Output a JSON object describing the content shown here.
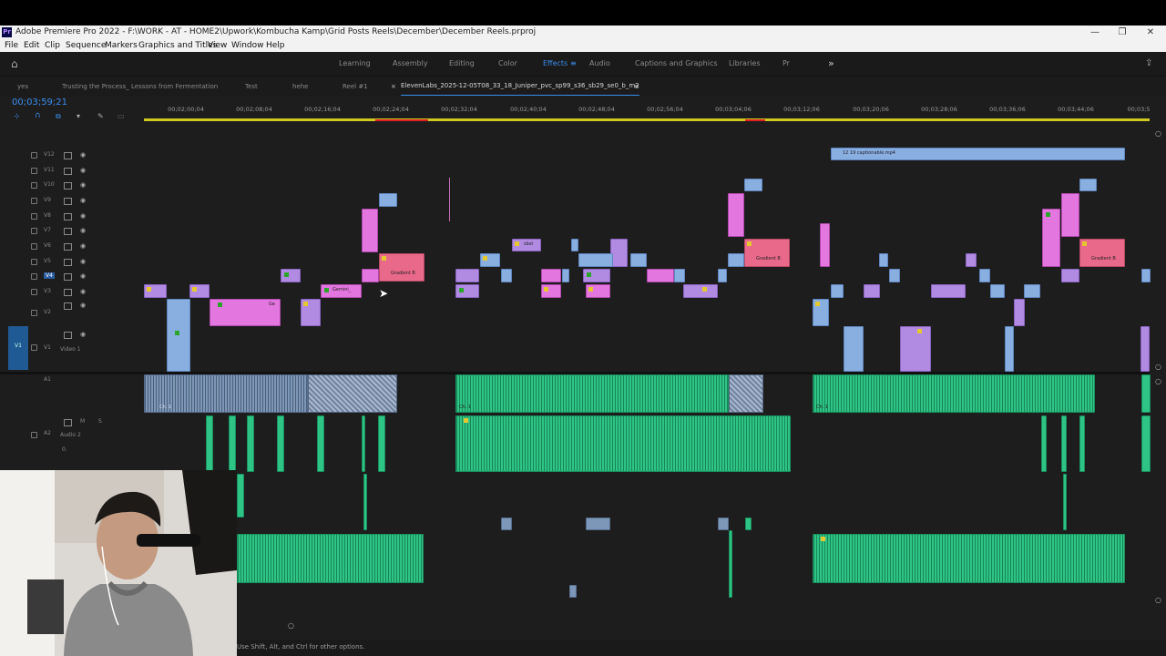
{
  "window": {
    "title": "Adobe Premiere Pro 2022 - F:\\WORK - AT - HOME2\\Upwork\\Kombucha Kamp\\Grid Posts Reels\\December\\December Reels.prproj",
    "app_badge": "Pr",
    "controls": [
      "—",
      "❐",
      "✕"
    ]
  },
  "menu": [
    "File",
    "Edit",
    "Clip",
    "Sequence",
    "Markers",
    "Graphics and Titles",
    "View",
    "Window",
    "Help"
  ],
  "workspaces": {
    "items": [
      "Learning",
      "Assembly",
      "Editing",
      "Color",
      "Effects",
      "Audio",
      "Captions and Graphics",
      "Libraries",
      "Pr"
    ],
    "active": "Effects",
    "more": "»"
  },
  "sequence_tabs": {
    "items": [
      "yes",
      "Trusting the Process_ Lessons from Fermentation",
      "Test",
      "hehe",
      "Reel #1",
      "ElevenLabs_2025-12-05T08_33_18_Juniper_pvc_sp99_s36_sb29_se0_b_m2"
    ],
    "close_glyph": "×",
    "menu_glyph": "≡"
  },
  "timecode": "00;03;59;21",
  "ruler_ticks": [
    "00;02;00;04",
    "00;02;08;04",
    "00;02;16;04",
    "00;02;24;04",
    "00;02;32;04",
    "00;02;40;04",
    "00;02;48;04",
    "00;02;56;04",
    "00;03;04;06",
    "00;03;12;06",
    "00;03;20;06",
    "00;03;28;06",
    "00;03;36;06",
    "00;03;44;06",
    "00;03;5"
  ],
  "video_tracks": [
    "V12",
    "V11",
    "V10",
    "V9",
    "V8",
    "V7",
    "V6",
    "V5",
    "V4",
    "V3",
    "V2",
    "V1"
  ],
  "video1_name": "Video 1",
  "audio_tracks": [
    "A1",
    "A2"
  ],
  "audio2_name": "Audio 2",
  "audio_track_buttons": [
    "M",
    "S"
  ],
  "audio_level": "0.",
  "clip_labels": {
    "captionable": "12 19 captionable.mp4",
    "gradient": "Gradient B",
    "gemini": "Gemini_",
    "ge": "Ge",
    "sbst": "sbst",
    "ch": "Ch. 1"
  },
  "status_text": "Use Shift, Alt, and Ctrl for other options.",
  "colors": {
    "accent": "#3b8ef0",
    "work_area": "#cfc820",
    "pink_clip": "#e476e0",
    "blue_clip": "#89aee0",
    "purple_clip": "#b18be2",
    "audio_clip": "#2ec486"
  }
}
